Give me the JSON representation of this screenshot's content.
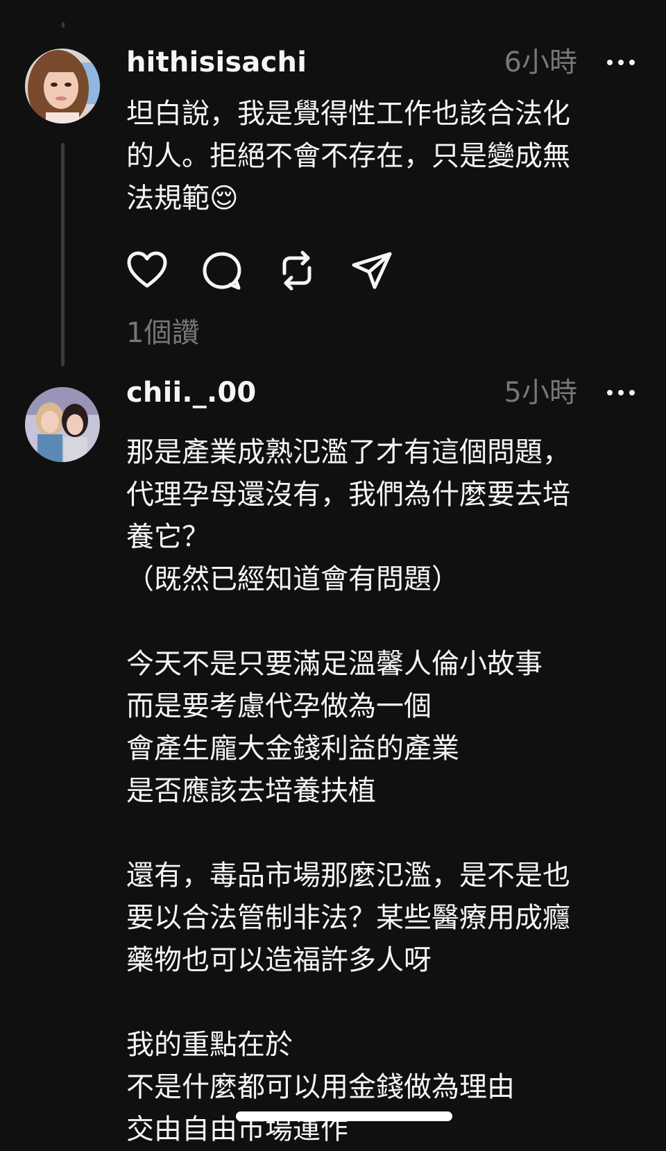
{
  "posts": [
    {
      "username": "hithisisachi",
      "time": "6小時",
      "body_lines": [
        "坦白說，我是覺得性工作也該合法化",
        "的人。拒絕不會不存在，只是變成無",
        "法規範😌"
      ],
      "likes": "1個讚"
    },
    {
      "username": "chii._.00",
      "time": "5小時",
      "body": "那是產業成熟氾濫了才有這個問題，\n代理孕母還沒有，我們為什麼要去培\n養它？\n（既然已經知道會有問題）\n\n今天不是只要滿足溫馨人倫小故事\n而是要考慮代孕做為一個\n會產生龐大金錢利益的產業\n是否應該去培養扶植\n\n還有，毒品市場那麼氾濫，是不是也\n要以合法管制非法？某些醫療用成癮\n藥物也可以造福許多人呀\n\n我的重點在於\n不是什麼都可以用金錢做為理由\n交由自由市場運作"
    }
  ],
  "icons": {
    "more": "more-horizontal-icon",
    "like": "heart-icon",
    "comment": "comment-bubble-icon",
    "repost": "repost-icon",
    "share": "send-icon"
  },
  "colors": {
    "background": "#101010",
    "text": "#f3f5f7",
    "muted": "#777777",
    "thread_line": "#3a3a3a"
  }
}
